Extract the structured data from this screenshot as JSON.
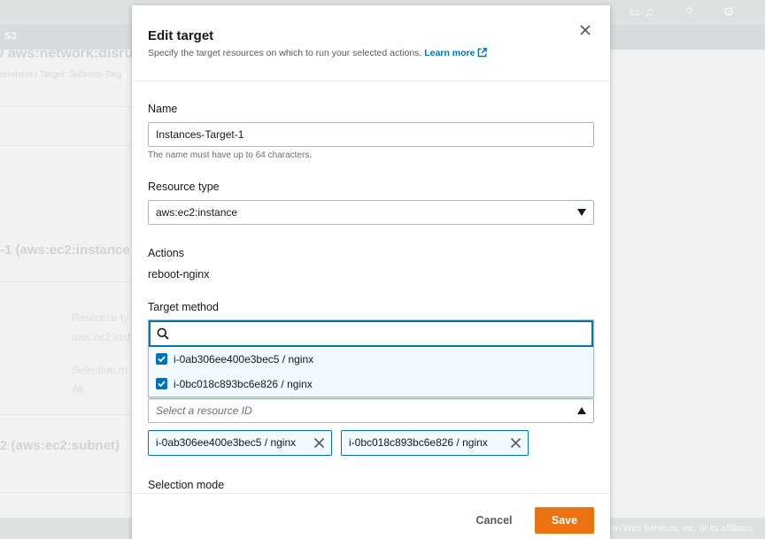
{
  "background": {
    "service_tab": "S3",
    "page_title": "/ aws:network:disru",
    "breadcrumb": "ernment / Target: Subnets-Targ",
    "section1_title": "-1 (aws:ec2:instance",
    "resource_type_label": "Resource ty",
    "resource_type_value": "aws:ec2:inst",
    "selection_mode_label": "Selection m",
    "selection_mode_value": "All",
    "section2_title": "2 (aws:ec2:subnet)",
    "footer_text": "on Web Services, Inc. or its affiliates"
  },
  "modal": {
    "title": "Edit target",
    "description": "Specify the target resources on which to run your selected actions.",
    "learn_more": "Learn more",
    "name": {
      "label": "Name",
      "value": "Instances-Target-1",
      "hint": "The name must have up to 64 characters."
    },
    "resource_type": {
      "label": "Resource type",
      "value": "aws:ec2:instance"
    },
    "actions": {
      "label": "Actions",
      "value": "reboot-nginx"
    },
    "target_method": {
      "label": "Target method"
    },
    "dropdown": {
      "search_placeholder": "",
      "options": [
        {
          "label": "i-0ab306ee400e3bec5 / nginx",
          "checked": true
        },
        {
          "label": "i-0bc018c893bc6e826 / nginx",
          "checked": true
        }
      ]
    },
    "resource_id": {
      "placeholder": "Select a resource ID"
    },
    "tokens": [
      {
        "label": "i-0ab306ee400e3bec5 / nginx"
      },
      {
        "label": "i-0bc018c893bc6e826 / nginx"
      }
    ],
    "selection_mode": {
      "label": "Selection mode"
    },
    "footer": {
      "cancel": "Cancel",
      "save": "Save"
    }
  },
  "colors": {
    "accent": "#0073bb",
    "primary_button": "#ec7211"
  }
}
